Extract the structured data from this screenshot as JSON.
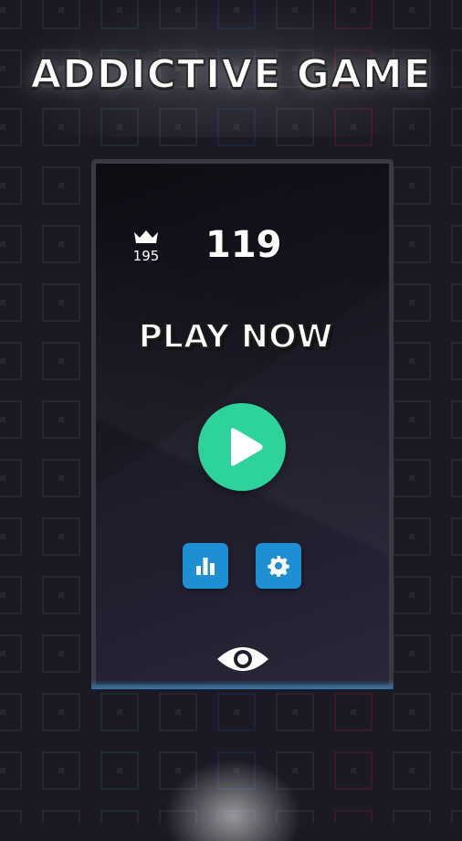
{
  "header": {
    "title": "ADDICTIVE GAME"
  },
  "card": {
    "best_score": "195",
    "current_score": "119",
    "cta_label": "PLAY NOW"
  },
  "icons": {
    "crown": "crown-icon",
    "play": "play-icon",
    "stats": "bar-chart-icon",
    "settings": "gear-icon",
    "visibility": "eye-icon"
  },
  "colors": {
    "play_button": "#2ed39b",
    "square_buttons": "#1e8fd2",
    "background": "#1b1a24"
  }
}
